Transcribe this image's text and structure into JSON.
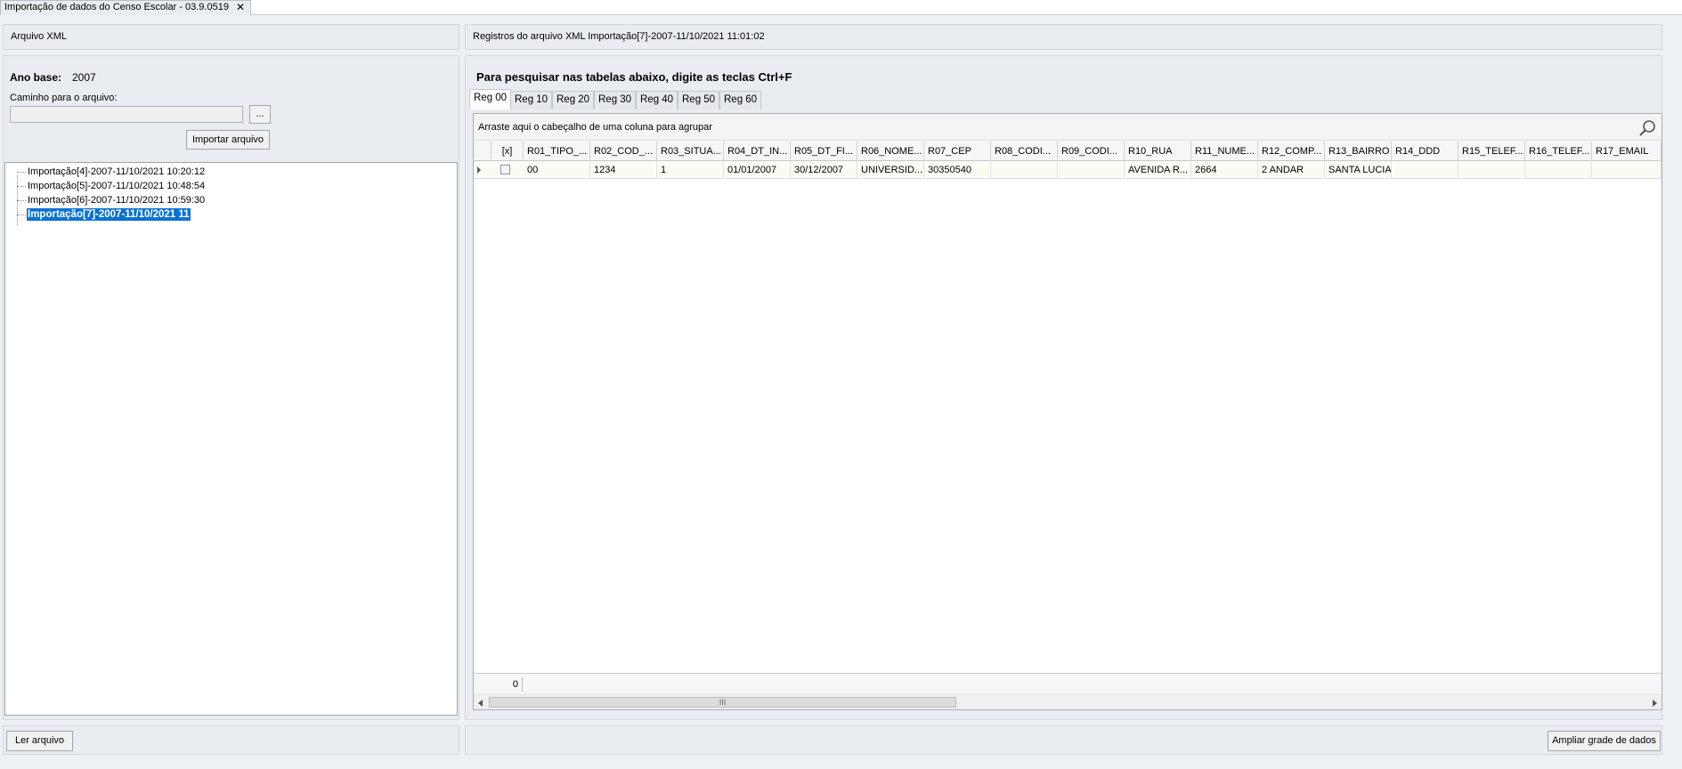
{
  "window": {
    "tab_title": "Importação de dados do Censo Escolar - 03.9.0519",
    "close_glyph": "✕"
  },
  "left_panel": {
    "header": "Arquivo XML",
    "ano_base_label": "Ano base:",
    "ano_base_value": "2007",
    "caminho_label": "Caminho para o arquivo:",
    "caminho_value": "",
    "browse_label": "...",
    "importar_label": "Importar arquivo",
    "tree_items": [
      "Importação[4]-2007-11/10/2021 10:20:12",
      "Importação[5]-2007-11/10/2021 10:48:54",
      "Importação[6]-2007-11/10/2021 10:59:30",
      "Importação[7]-2007-11/10/2021 11"
    ],
    "selected_index": 3,
    "ler_label": "Ler arquivo"
  },
  "right_panel": {
    "header": "Registros do arquivo XML Importação[7]-2007-11/10/2021 11:01:02",
    "search_hint": "Para pesquisar nas tabelas abaixo, digite as teclas Ctrl+F",
    "tabs": [
      "Reg 00",
      "Reg 10",
      "Reg 20",
      "Reg 30",
      "Reg 40",
      "Reg 50",
      "Reg 60"
    ],
    "active_tab": "Reg 00",
    "group_panel_text": "Arraste aqui o cabeçalho de uma coluna para agrupar",
    "search_icon": "search-icon",
    "columns": [
      "[x]",
      "R01_TIPO_...",
      "R02_COD_...",
      "R03_SITUA...",
      "R04_DT_IN...",
      "R05_DT_FI...",
      "R06_NOME...",
      "R07_CEP",
      "R08_CODI...",
      "R09_CODI...",
      "R10_RUA",
      "R11_NUME...",
      "R12_COMP...",
      "R13_BAIRRO",
      "R14_DDD",
      "R15_TELEF...",
      "R16_TELEF...",
      "R17_EMAIL"
    ],
    "rows": [
      [
        "",
        "00",
        "1234",
        "1",
        "01/01/2007",
        "30/12/2007",
        "UNIVERSID...",
        "30350540",
        "",
        "",
        "AVENIDA R...",
        "2664",
        "2 ANDAR",
        "SANTA LUCIA",
        "",
        "",
        "",
        ""
      ]
    ],
    "footer_count": "0",
    "scroll_thumb_grip": "III",
    "ampliar_label": "Ampliar grade de dados"
  },
  "colors": {
    "selection": "#0c72d2",
    "panel_bg": "#e9ecf0",
    "row_bg": "#fcfbf3"
  }
}
